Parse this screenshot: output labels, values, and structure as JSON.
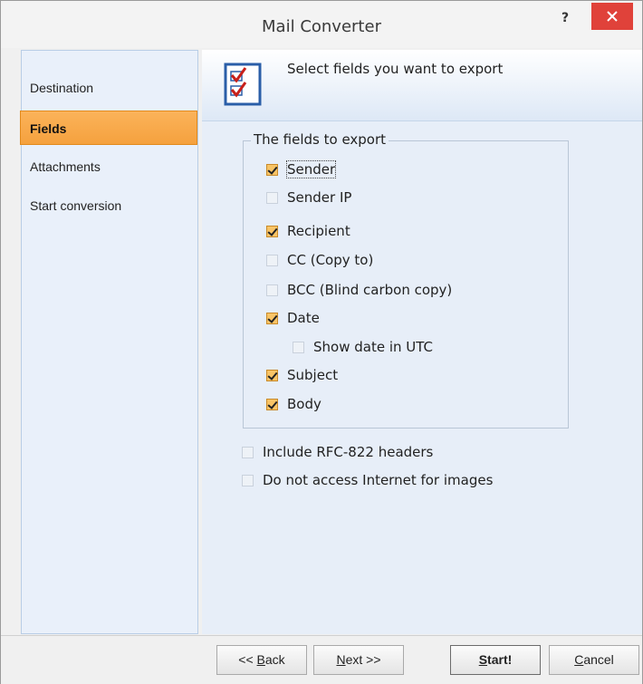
{
  "window": {
    "title": "Mail Converter",
    "help_glyph": "?"
  },
  "sidebar": {
    "items": [
      {
        "label": "Destination",
        "active": false
      },
      {
        "label": "Fields",
        "active": true
      },
      {
        "label": "Attachments",
        "active": false
      },
      {
        "label": "Start conversion",
        "active": false
      }
    ]
  },
  "header": {
    "text": "Select fields you want to export",
    "icon": "checklist-icon"
  },
  "fields_group": {
    "legend": "The fields to export",
    "items": [
      {
        "label": "Sender",
        "checked": true
      },
      {
        "label": "Sender IP",
        "checked": false
      },
      {
        "label": "Recipient",
        "checked": true
      },
      {
        "label": "CC (Copy to)",
        "checked": false
      },
      {
        "label": "BCC (Blind carbon copy)",
        "checked": false
      },
      {
        "label": "Date",
        "checked": true
      },
      {
        "label": "Show date in UTC",
        "checked": false
      },
      {
        "label": "Subject",
        "checked": true
      },
      {
        "label": "Body",
        "checked": true
      }
    ]
  },
  "options": [
    {
      "label": "Include RFC-822 headers",
      "checked": false
    },
    {
      "label": "Do not access Internet for images",
      "checked": false
    }
  ],
  "footer": {
    "back_pre": "<< ",
    "back_ul": "B",
    "back_post": "ack",
    "next_ul": "N",
    "next_post": "ext >>",
    "start_ul": "S",
    "start_post": "tart!",
    "cancel_ul": "C",
    "cancel_post": "ancel"
  },
  "colors": {
    "accent": "#f5a13e",
    "close": "#e0423a",
    "panel": "#e7eef8"
  }
}
